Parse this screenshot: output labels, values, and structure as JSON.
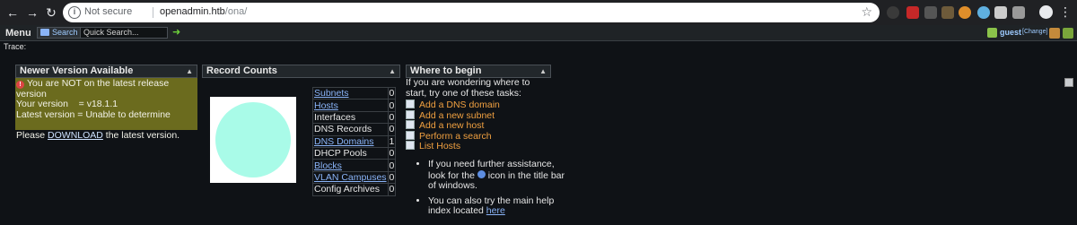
{
  "browser": {
    "security_label": "Not secure",
    "url_host": "openadmin.htb",
    "url_path": "/ona/"
  },
  "appbar": {
    "menu_label": "Menu",
    "search_label": "Search",
    "quick_search_value": "Quick Search...",
    "user_name": "guest",
    "user_change": "[Change]"
  },
  "trace_label": "Trace:",
  "newer_version": {
    "title": "Newer Version Available",
    "warning": "You are NOT on the latest release version",
    "your_version": "Your version    = v18.1.1",
    "latest_version": "Latest version = Unable to determine",
    "download_prefix": "Please ",
    "download_link": "DOWNLOAD",
    "download_suffix": " the latest version."
  },
  "record_counts": {
    "title": "Record Counts",
    "pie_color": "#a9fbe8",
    "rows": [
      {
        "label": "Subnets",
        "value": "0",
        "link": true
      },
      {
        "label": "Hosts",
        "value": "0",
        "link": true
      },
      {
        "label": "Interfaces",
        "value": "0",
        "link": false
      },
      {
        "label": "DNS Records",
        "value": "0",
        "link": false
      },
      {
        "label": "DNS Domains",
        "value": "1",
        "link": true
      },
      {
        "label": "DHCP Pools",
        "value": "0",
        "link": false
      },
      {
        "label": "Blocks",
        "value": "0",
        "link": true
      },
      {
        "label": "VLAN Campuses",
        "value": "0",
        "link": true
      },
      {
        "label": "Config Archives",
        "value": "0",
        "link": false
      }
    ]
  },
  "where_to_begin": {
    "title": "Where to begin",
    "intro": "If you are wondering where to start, try one of these tasks:",
    "tasks": [
      "Add a DNS domain",
      "Add a new subnet",
      "Add a new host",
      "Perform a search",
      "List Hosts"
    ],
    "help1_a": "If you need further assistance, look for the ",
    "help1_b": " icon in the title bar of windows.",
    "help2_a": "You can also try the main help index located ",
    "help2_link": "here"
  }
}
